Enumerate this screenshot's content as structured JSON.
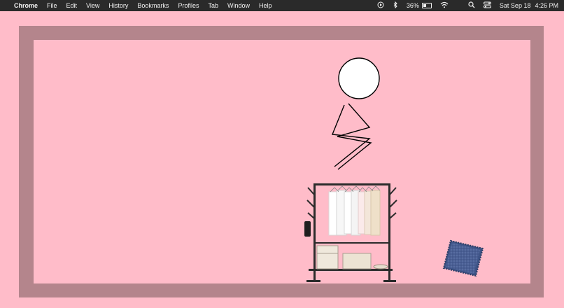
{
  "menubar": {
    "apple": "",
    "app_name": "Chrome",
    "menus": [
      "File",
      "Edit",
      "View",
      "History",
      "Bookmarks",
      "Profiles",
      "Tab",
      "Window",
      "Help"
    ],
    "battery_percent": "36%",
    "date": "Sat Sep 18",
    "time": "4:26 PM",
    "status_icons": [
      "play-circle-icon",
      "bluetooth-icon",
      "battery-icon",
      "wifi-icon",
      "search-icon",
      "control-center-icon"
    ]
  },
  "scene": {
    "background_color": "#ffbcc9",
    "wall_frame_color": "#b4858c",
    "objects": [
      "stick-figure",
      "clothes-rack",
      "denim-swatch"
    ]
  }
}
